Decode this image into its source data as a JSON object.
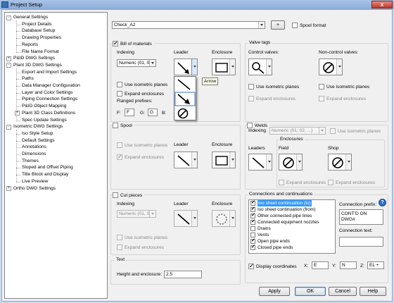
{
  "window": {
    "title": "Project Setup",
    "close_label": "x"
  },
  "tree": [
    {
      "label": "General Settings",
      "level": 0,
      "expander": "-"
    },
    {
      "label": "Project Details",
      "level": 1
    },
    {
      "label": "Database Setup",
      "level": 1
    },
    {
      "label": "Drawing Properties",
      "level": 1
    },
    {
      "label": "Reports",
      "level": 1
    },
    {
      "label": "File Name Format",
      "level": 1
    },
    {
      "label": "P&ID DWG Settings",
      "level": 0,
      "expander": "+"
    },
    {
      "label": "Plant 3D DWG Settings",
      "level": 0,
      "expander": "-"
    },
    {
      "label": "Export and Import Settings",
      "level": 1
    },
    {
      "label": "Paths",
      "level": 1
    },
    {
      "label": "Data Manager Configuration",
      "level": 1
    },
    {
      "label": "Layer and Color Settings",
      "level": 1
    },
    {
      "label": "Piping Connection Settings",
      "level": 1
    },
    {
      "label": "P&ID Object Mapping",
      "level": 1
    },
    {
      "label": "Plant 3D Class Definitions",
      "level": 1,
      "expander": "+"
    },
    {
      "label": "Spec Update Settings",
      "level": 1
    },
    {
      "label": "Isometric DWG Settings",
      "level": 0,
      "expander": "-"
    },
    {
      "label": "Iso Style Setup",
      "level": 1
    },
    {
      "label": "Default Settings",
      "level": 1
    },
    {
      "label": "Annotations",
      "level": 1
    },
    {
      "label": "Dimensions",
      "level": 1
    },
    {
      "label": "Themes",
      "level": 1
    },
    {
      "label": "Sloped and Offset Piping",
      "level": 1
    },
    {
      "label": "Title Block and Display",
      "level": 1
    },
    {
      "label": "Live Preview",
      "level": 1
    },
    {
      "label": "Ortho DWG Settings",
      "level": 0,
      "expander": "+"
    }
  ],
  "top": {
    "style_value": "Check_A2",
    "add_label": "+",
    "spool_format_label": "Spool format"
  },
  "bom": {
    "label": "Bill of materials",
    "indexing_label": "Indexing",
    "indexing_value": "Numeric (01, 0",
    "leader_label": "Leader",
    "enclosure_label": "Enclosure",
    "use_iso_label": "Use isometric planes",
    "expand_label": "Expand enclosures",
    "flanged_label": "Flanged prefixes:",
    "flanged_fields": [
      {
        "label": "F:",
        "value": "F"
      },
      {
        "label": "G:",
        "value": "G"
      },
      {
        "label": "B:",
        "value": "B"
      }
    ],
    "tooltip": "Arrow"
  },
  "valve": {
    "label": "Valve tags",
    "control_label": "Control valves:",
    "noncontrol_label": "Non-control valves:",
    "use_iso_label": "Use isometric planes",
    "expand_label": "Expand enclosures"
  },
  "spool": {
    "label": "Spool",
    "leader_label": "Leader",
    "enclosure_label": "Enclosure",
    "use_iso_label": "Use isometric planes",
    "expand_label": "Expand enclosures"
  },
  "welds": {
    "label": "Welds",
    "indexing_label": "Indexing",
    "indexing_value": "Numeric (01, 02, ...)",
    "use_iso_label": "Use isometric planes",
    "enclosures_label": "Enclosures",
    "leaders_label": "Leaders",
    "field_label": "Field",
    "shop_label": "Shop",
    "expand_label": "Expand enclosures"
  },
  "cut": {
    "label": "Cut pieces",
    "indexing_label": "Indexing",
    "indexing_value": "Numeric (01, 0",
    "leader_label": "Leader",
    "enclosure_label": "Enclosure",
    "use_iso_label": "Use isometric planes",
    "expand_label": "Expand enclosures"
  },
  "text": {
    "label": "Text",
    "height_label": "Height and enclosure:",
    "height_value": "2.5"
  },
  "connections": {
    "label": "Connections and continuations",
    "items": [
      {
        "label": "Iso sheet continuation (to)",
        "checked": true
      },
      {
        "label": "Iso sheet continuation (from)",
        "checked": true
      },
      {
        "label": "Other connected pipe lines",
        "checked": true
      },
      {
        "label": "Connected equipment nozzles",
        "checked": true
      },
      {
        "label": "Drains",
        "checked": false
      },
      {
        "label": "Vents",
        "checked": false
      },
      {
        "label": "Open pipe ends",
        "checked": true
      },
      {
        "label": "Closed pipe ends",
        "checked": true
      }
    ],
    "prefix_label": "Connection prefix:",
    "prefix_value_line1": "CONT'D ON",
    "prefix_value_line2": "DWG#",
    "text_label": "Connection text:",
    "help_label": "?"
  },
  "coords": {
    "label": "Display coordinates",
    "x_label": "X:",
    "x_value": "E",
    "y_label": "Y:",
    "y_value": "N",
    "z_label": "Z:",
    "z_value": "EL +"
  },
  "buttons": {
    "apply": "Apply",
    "ok": "OK",
    "cancel": "Cancel",
    "help": "Help"
  }
}
